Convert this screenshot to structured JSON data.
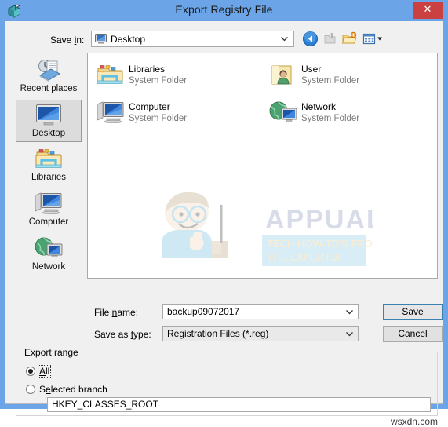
{
  "window": {
    "title": "Export Registry File",
    "app_icon": "registry-editor-icon",
    "close_label": "✕",
    "titlebar_color": "#6ba4e7",
    "close_color": "#cb4040"
  },
  "toolbar": {
    "save_in_label": "Save in:",
    "save_in_mnemonic": "i",
    "current_folder": "Desktop",
    "buttons": [
      {
        "name": "back-button",
        "icon": "back-arrow-icon",
        "enabled": true
      },
      {
        "name": "up-one-level-button",
        "icon": "up-folder-icon",
        "enabled": false
      },
      {
        "name": "new-folder-button",
        "icon": "new-folder-icon",
        "enabled": true
      },
      {
        "name": "views-button",
        "icon": "views-icon",
        "enabled": true
      }
    ]
  },
  "places": [
    {
      "label": "Recent places",
      "icon": "recent-places-icon",
      "selected": false
    },
    {
      "label": "Desktop",
      "icon": "desktop-icon",
      "selected": true
    },
    {
      "label": "Libraries",
      "icon": "libraries-icon",
      "selected": false
    },
    {
      "label": "Computer",
      "icon": "computer-icon",
      "selected": false
    },
    {
      "label": "Network",
      "icon": "network-icon",
      "selected": false
    }
  ],
  "file_list": [
    {
      "name": "Libraries",
      "type": "System Folder",
      "icon": "libraries-folder-icon"
    },
    {
      "name": "User",
      "type": "System Folder",
      "icon": "user-folder-icon"
    },
    {
      "name": "Computer",
      "type": "System Folder",
      "icon": "computer-icon"
    },
    {
      "name": "Network",
      "type": "System Folder",
      "icon": "network-icon"
    }
  ],
  "watermark": {
    "brand": "APPUALS",
    "tagline_line1": "TECH HOW-TO'S FROM",
    "tagline_line2": "THE EXPERTS!"
  },
  "form": {
    "filename_label": "File name:",
    "filename_mnemonic": "n",
    "filename_value": "backup09072017",
    "savetype_label": "Save as type:",
    "savetype_mnemonic": "t",
    "savetype_value": "Registration Files (*.reg)",
    "save_button": "Save",
    "save_mnemonic": "S",
    "cancel_button": "Cancel"
  },
  "export_range": {
    "legend": "Export range",
    "option_all": "All",
    "option_all_mnemonic": "A",
    "option_all_selected": true,
    "option_branch": "Selected branch",
    "option_branch_mnemonic": "e",
    "option_branch_selected": false,
    "branch_value": "HKEY_CLASSES_ROOT"
  },
  "footer": {
    "site_watermark": "wsxdn.com"
  }
}
